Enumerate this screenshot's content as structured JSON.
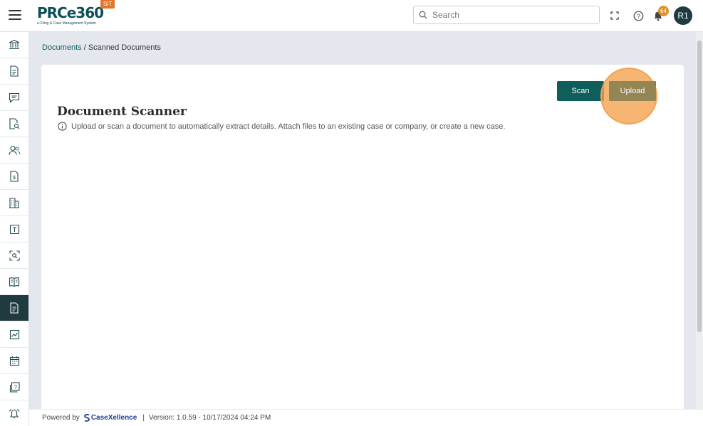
{
  "app": {
    "logo_text": "PRCe360",
    "logo_subtitle": "e-Filing & Case Management System",
    "env_badge": "SIT"
  },
  "header": {
    "search_placeholder": "Search",
    "notification_count": "64",
    "avatar_initials": "R1"
  },
  "sidebar": {
    "items": [
      {
        "icon": "bank-icon",
        "active": false
      },
      {
        "icon": "document-icon",
        "active": false
      },
      {
        "icon": "chat-icon",
        "active": false
      },
      {
        "icon": "document-search-icon",
        "active": false
      },
      {
        "icon": "users-icon",
        "active": false
      },
      {
        "icon": "invoice-icon",
        "active": false
      },
      {
        "icon": "building-icon",
        "active": false
      },
      {
        "icon": "template-icon",
        "active": false
      },
      {
        "icon": "scan-icon",
        "active": false
      },
      {
        "icon": "book-icon",
        "active": false
      },
      {
        "icon": "scanned-document-icon",
        "active": true
      },
      {
        "icon": "chart-icon",
        "active": false
      },
      {
        "icon": "calendar-icon",
        "active": false
      },
      {
        "icon": "help-document-icon",
        "active": false
      },
      {
        "icon": "alarm-icon",
        "active": false
      }
    ]
  },
  "breadcrumb": {
    "parent": "Documents",
    "separator": " / ",
    "current": "Scanned Documents"
  },
  "main": {
    "title": "Document Scanner",
    "info_text": "Upload or scan a document to automatically extract details. Attach files to an existing case or company, or create a new case.",
    "scan_label": "Scan",
    "upload_label": "Upload"
  },
  "footer": {
    "powered_by": "Powered by",
    "brand": "CaseXellence",
    "separator": "|",
    "version": "Version: 1.0.59 - 10/17/2024 04:24 PM"
  },
  "colors": {
    "primary": "#0e5f5b",
    "sidebar_active": "#1f3b3f",
    "accent_badge": "#e0762b",
    "highlight": "#f5a04b"
  }
}
